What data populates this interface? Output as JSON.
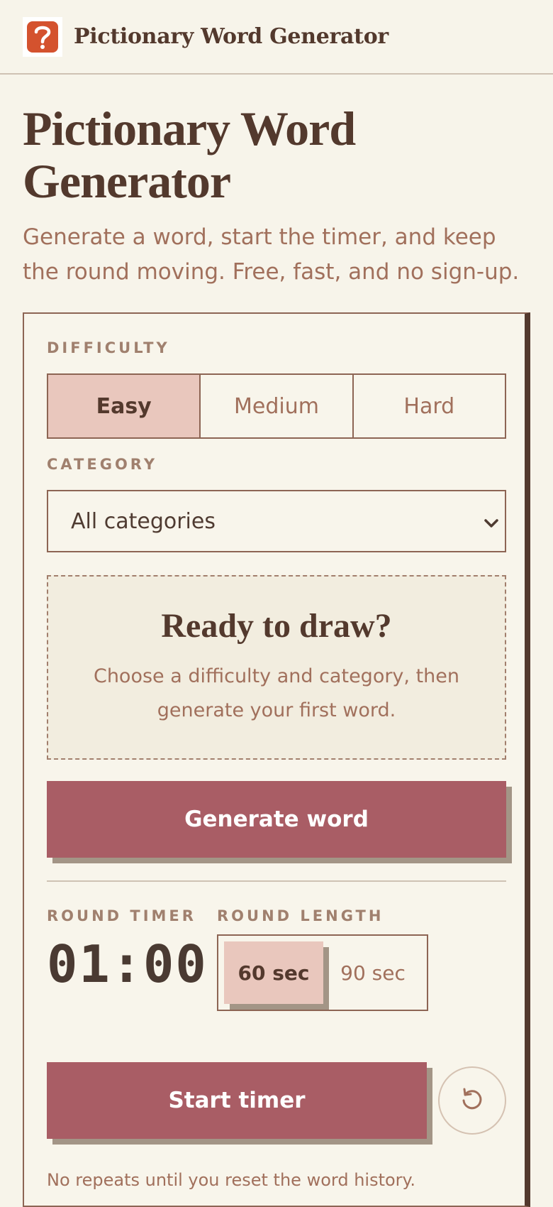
{
  "header": {
    "brand": "Pictionary Word Generator",
    "logo_icon": "question-mark-icon",
    "logo_color": "#d4522e"
  },
  "hero": {
    "title": "Pictionary Word Generator",
    "subtitle": "Generate a word, start the timer, and keep the round moving. Free, fast, and no sign-up."
  },
  "difficulty": {
    "label": "DIFFICULTY",
    "options": [
      "Easy",
      "Medium",
      "Hard"
    ],
    "selected": "Easy"
  },
  "category": {
    "label": "CATEGORY",
    "selected": "All categories"
  },
  "ready": {
    "title": "Ready to draw?",
    "text": "Choose a difficulty and category, then generate your first word."
  },
  "generate_label": "Generate word",
  "timer": {
    "label": "ROUND TIMER",
    "value": "01:00"
  },
  "round_length": {
    "label": "ROUND LENGTH",
    "options": [
      "60 sec",
      "90 sec"
    ],
    "selected": "60 sec"
  },
  "start_label": "Start timer",
  "reset_icon": "reset-icon",
  "note": "No repeats until you reset the word history.",
  "colors": {
    "accent": "#a95d65",
    "selected_bg": "#e9c7bd",
    "text_dark": "#53392d",
    "text_muted": "#a1705c",
    "page_bg": "#f7f4ea"
  }
}
